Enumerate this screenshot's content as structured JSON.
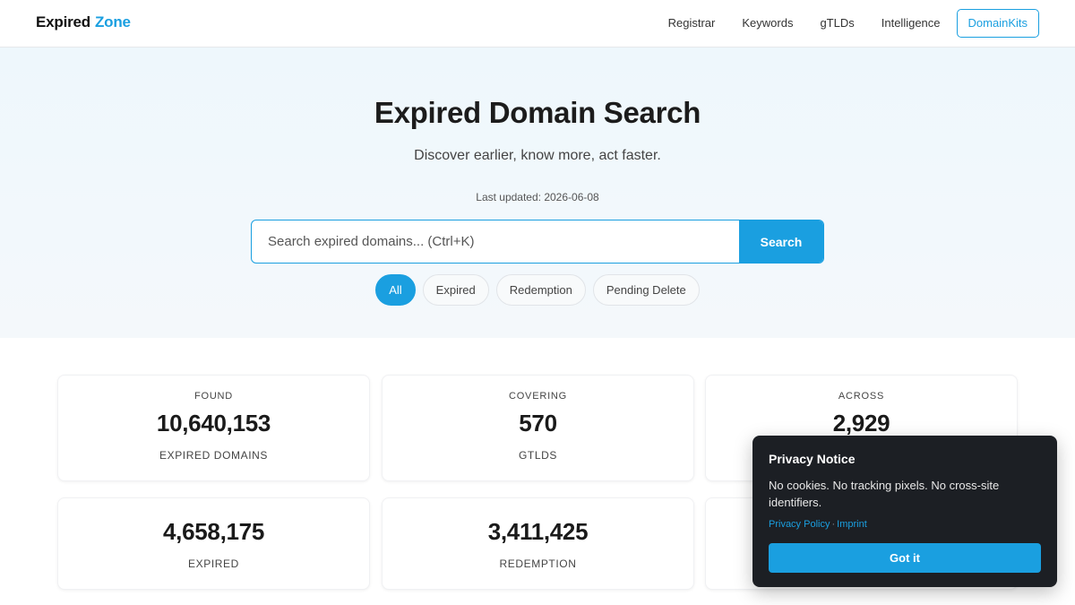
{
  "header": {
    "logo_part1": "Expired",
    "logo_part2": "Zone",
    "nav": [
      "Registrar",
      "Keywords",
      "gTLDs",
      "Intelligence"
    ],
    "cta": "DomainKits"
  },
  "hero": {
    "title": "Expired Domain Search",
    "subtitle": "Discover earlier, know more, act faster.",
    "last_updated": "Last updated: 2026-06-08",
    "search_placeholder": "Search expired domains... (Ctrl+K)",
    "search_button": "Search",
    "filters": [
      {
        "label": "All",
        "active": true
      },
      {
        "label": "Expired",
        "active": false
      },
      {
        "label": "Redemption",
        "active": false
      },
      {
        "label": "Pending Delete",
        "active": false
      }
    ]
  },
  "stats": {
    "found": {
      "top": "FOUND",
      "value": "10,640,153",
      "bottom": "EXPIRED DOMAINS"
    },
    "covering": {
      "top": "COVERING",
      "value": "570",
      "bottom": "GTLDS"
    },
    "across": {
      "top": "ACROSS",
      "value": "2,929"
    },
    "expired": {
      "value": "4,658,175",
      "bottom": "EXPIRED"
    },
    "redemption": {
      "value": "3,411,425",
      "bottom": "REDEMPTION"
    }
  },
  "privacy": {
    "title": "Privacy Notice",
    "body": "No cookies. No tracking pixels. No cross-site identifiers.",
    "link_policy": "Privacy Policy",
    "link_sep": "·",
    "link_imprint": "Imprint",
    "button": "Got it"
  },
  "colors": {
    "accent": "#1a9fe0",
    "dark_panel": "#1c1f24"
  }
}
